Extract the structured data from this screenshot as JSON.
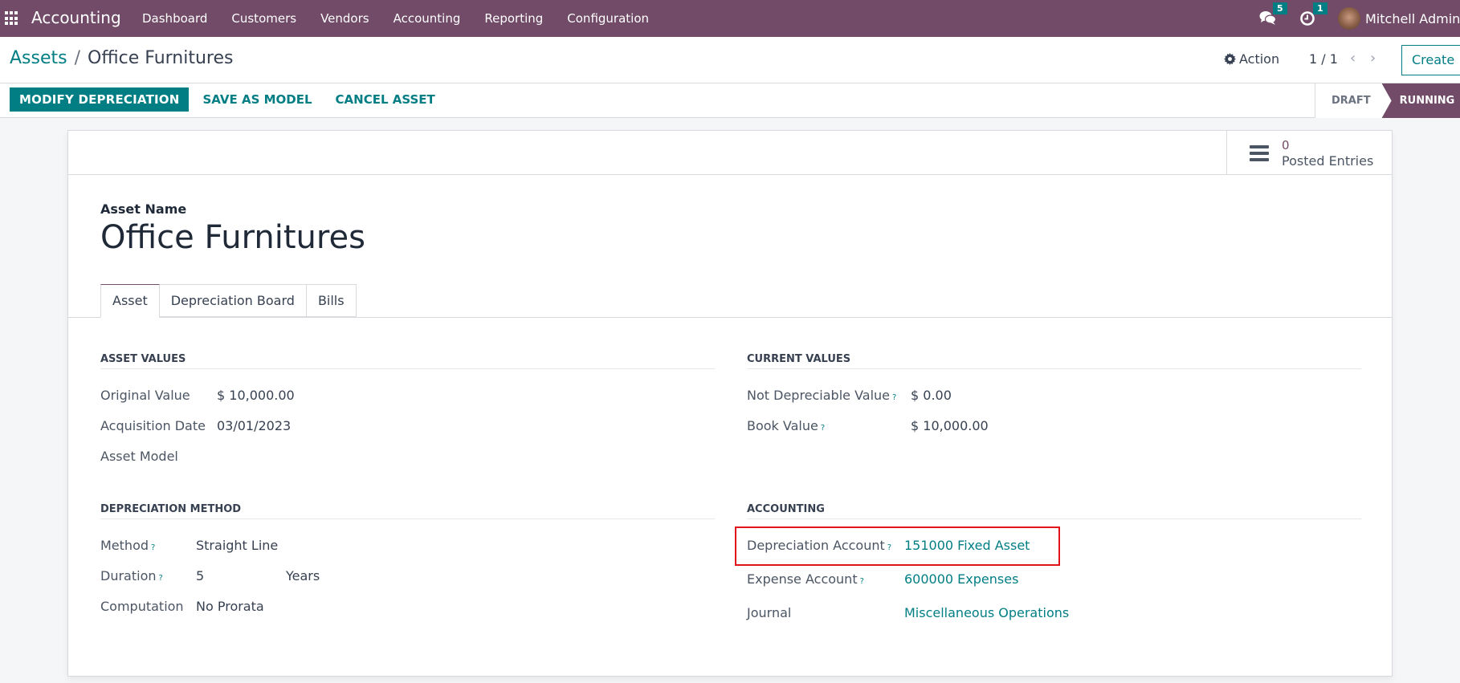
{
  "navbar": {
    "app_name": "Accounting",
    "menu": [
      "Dashboard",
      "Customers",
      "Vendors",
      "Accounting",
      "Reporting",
      "Configuration"
    ],
    "messages_count": "5",
    "activities_count": "1",
    "user_name": "Mitchell Admin",
    "icons": {
      "apps": "apps-grid-icon",
      "messages": "chat-bubbles-icon",
      "activities": "clock-icon"
    }
  },
  "breadcrumb": {
    "parent": "Assets",
    "separator": "/",
    "current": "Office Furnitures"
  },
  "control": {
    "action_label": "Action",
    "pager": "1 / 1",
    "pager_prev": "‹",
    "pager_next": "›",
    "create_label": "Create"
  },
  "statusbar": {
    "buttons": [
      "MODIFY DEPRECIATION",
      "SAVE AS MODEL",
      "CANCEL ASSET"
    ],
    "stages": [
      "DRAFT",
      "RUNNING"
    ],
    "active_stage": "RUNNING"
  },
  "smart_button": {
    "value": "0",
    "label": "Posted Entries"
  },
  "form": {
    "title_label": "Asset Name",
    "title_value": "Office Furnitures",
    "tabs": [
      "Asset",
      "Depreciation Board",
      "Bills"
    ],
    "active_tab": "Asset",
    "asset_values": {
      "title": "ASSET VALUES",
      "fields": [
        {
          "label": "Original Value",
          "value": "$ 10,000.00",
          "help": false
        },
        {
          "label": "Acquisition Date",
          "value": "03/01/2023",
          "help": false
        },
        {
          "label": "Asset Model",
          "value": "",
          "help": false
        }
      ]
    },
    "current_values": {
      "title": "CURRENT VALUES",
      "fields": [
        {
          "label": "Not Depreciable Value",
          "value": "$ 0.00",
          "help": true
        },
        {
          "label": "Book Value",
          "value": "$ 10,000.00",
          "help": true
        }
      ]
    },
    "depreciation_method": {
      "title": "DEPRECIATION METHOD",
      "fields": [
        {
          "label": "Method",
          "value": "Straight Line",
          "help": true
        },
        {
          "label": "Duration",
          "value": "5",
          "unit": "Years",
          "help": true
        },
        {
          "label": "Computation",
          "value": "No Prorata",
          "help": false
        }
      ]
    },
    "accounting": {
      "title": "ACCOUNTING",
      "fields": [
        {
          "label": "Depreciation Account",
          "value": "151000 Fixed Asset",
          "help": true,
          "highlighted": true
        },
        {
          "label": "Expense Account",
          "value": "600000 Expenses",
          "help": true
        },
        {
          "label": "Journal",
          "value": "Miscellaneous Operations",
          "help": false
        }
      ]
    },
    "help_marker": "?"
  },
  "colors": {
    "brand": "#714b67",
    "accent": "#017e84",
    "highlight": "#e2141a"
  }
}
